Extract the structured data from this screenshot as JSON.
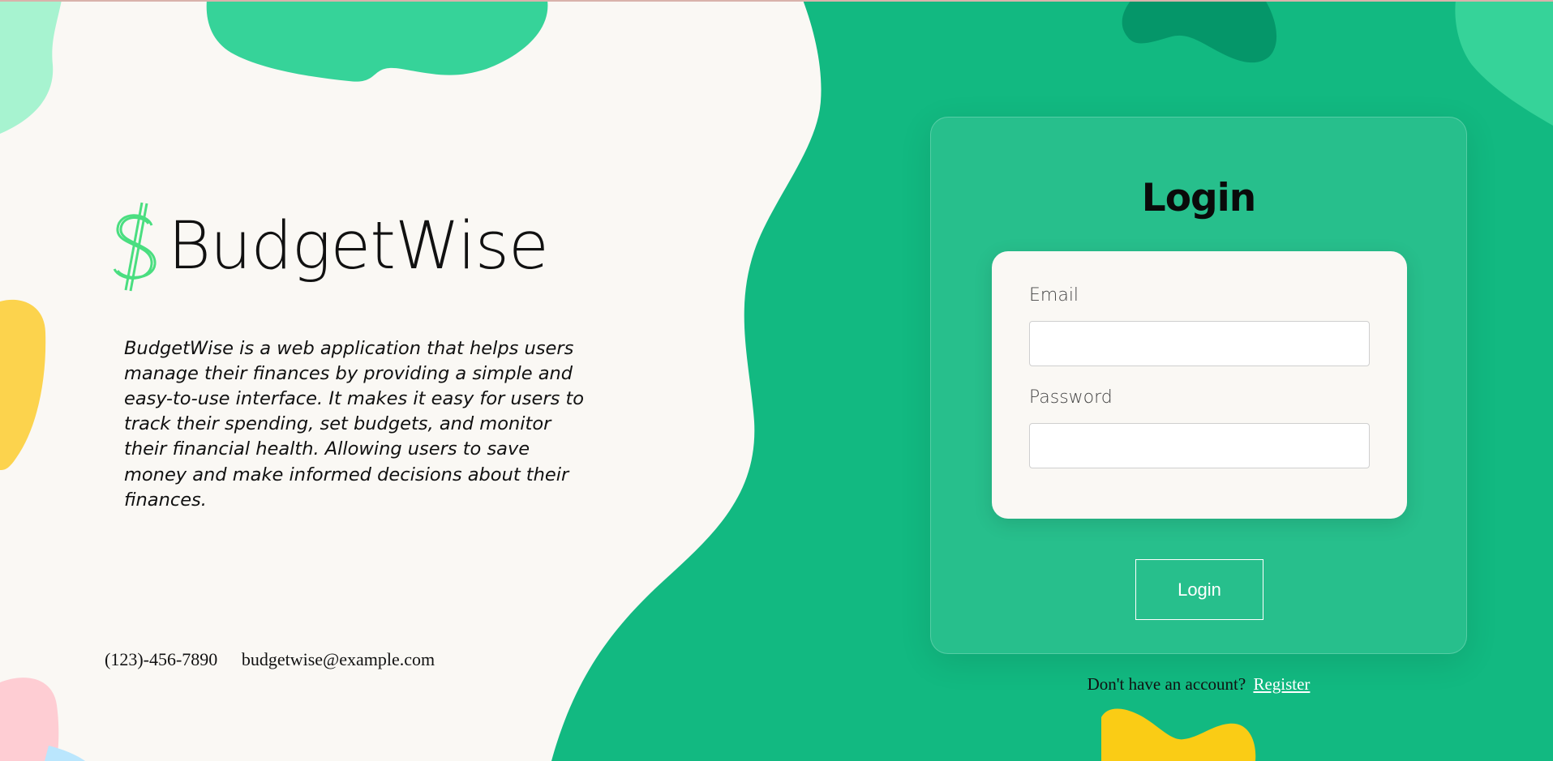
{
  "brand": {
    "name": "BudgetWise",
    "icon": "dollar-icon",
    "description": "BudgetWise is a web application that helps users manage their finances by providing a simple and easy-to-use interface. It makes it easy for users to track their spending, set budgets, and monitor their financial health. Allowing users to save money and make informed decisions about their finances."
  },
  "contact": {
    "phone": "(123)-456-7890",
    "email": "budgetwise@example.com"
  },
  "login": {
    "title": "Login",
    "email_label": "Email",
    "email_value": "",
    "password_label": "Password",
    "password_value": "",
    "button_label": "Login",
    "register_prompt": "Don't have an account?",
    "register_link": "Register"
  },
  "colors": {
    "background": "#faf8f4",
    "green": "#12b981",
    "dark_green": "#059669",
    "light_green": "#36d399",
    "mint": "#a7f3d0",
    "yellow": "#fcd34d",
    "pink": "#fecdd3"
  }
}
